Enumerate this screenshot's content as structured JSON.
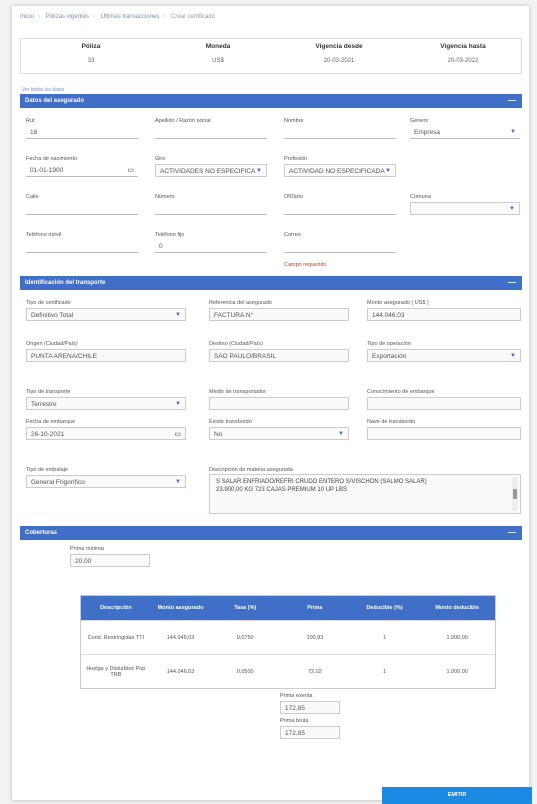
{
  "breadcrumb": [
    "Inicio",
    "Pólizas vigentes",
    "Últimas transacciones",
    "Crear certificado"
  ],
  "summary": {
    "headers": [
      "Póliza",
      "Moneda",
      "Vigencia desde",
      "Vigencia hasta"
    ],
    "values": [
      "33",
      "US$",
      "20-03-2021",
      "20-03-2022"
    ]
  },
  "small_link": "Ver todos los datos",
  "asegurado": {
    "title": "Datos del asegurado",
    "rut_label": "Rut",
    "rut_value": "18",
    "apellido_label": "Apellido / Razón social",
    "apellido_value": "",
    "nombre_label": "Nombre",
    "nombre_value": "",
    "genero_label": "Género",
    "genero_value": "Empresa",
    "fecha_nac_label": "Fecha de nacimiento",
    "fecha_nac_value": "01-01-1900",
    "giro_label": "Giro",
    "giro_value": "ACTIVIDADES NO ESPECIFICA",
    "profesion_label": "Profesión",
    "profesion_value": "ACTIVIDAD NO ESPECIFICADA",
    "calle_label": "Calle",
    "calle_value": "",
    "numero_label": "Número",
    "numero_value": "",
    "ofdpto_label": "Of/Dpto",
    "ofdpto_value": "",
    "comuna_label": "Comuna",
    "comuna_value": "",
    "tel_movil_label": "Teléfono móvil",
    "tel_movil_value": "",
    "tel_fijo_label": "Teléfono fijo",
    "tel_fijo_value": "0",
    "correo_label": "Correo",
    "correo_value": "",
    "correo_error": "Campo requerido"
  },
  "transporte": {
    "title": "Identificación del transporte",
    "tipo_cert_label": "Tipo de certificado",
    "tipo_cert_value": "Definitivo Total",
    "referencia_label": "Referencia del asegurado",
    "referencia_value": "FACTURA N°",
    "monto_label": "Monto asegurado ( US$ )",
    "monto_value": "144.046,03",
    "origen_label": "Origen (Ciudad/País)",
    "origen_value": "PUNTA ARENA/CHILE",
    "destino_label": "Destino (Ciudad/País)",
    "destino_value": "SAO PAULO/BRASIL",
    "tipo_op_label": "Tipo de operación",
    "tipo_op_value": "Exportación",
    "tipo_transp_label": "Tipo de transporte",
    "tipo_transp_value": "Terrestre",
    "medio_label": "Medio de transportador",
    "medio_value": "",
    "conocimiento_label": "Conocimiento de embarque",
    "conocimiento_value": "",
    "fecha_emb_label": "Fecha de embarque",
    "fecha_emb_value": "26-10-2021",
    "existe_transb_label": "Existe transbordo",
    "existe_transb_value": "No",
    "nave_transb_label": "Nave de transbordo",
    "nave_transb_value": "",
    "tipo_embalaje_label": "Tipo de embalaje",
    "tipo_embalaje_value": "General Frigorífico",
    "descripcion_label": "Descripción de materia asegurada",
    "descripcion_line1": "S SALAR ENFRIADO/REFRI CRUDO ENTERO S/VISCHON (SALMO SALAR)",
    "descripcion_line2": "23.900,00 KG      723 CAJAS        PREMIUM 10 UP LBS"
  },
  "coberturas": {
    "title": "Coberturas",
    "prima_minima_label": "Prima mínima",
    "prima_minima_value": "20,00",
    "headers": [
      "Descripción",
      "Monto asegurado",
      "Tasa (%)",
      "Prima",
      "Deducible (%)",
      "Monto deducible"
    ],
    "rows": [
      [
        "Cond. Restringidas TTI",
        "144.046,03",
        "0,0750",
        "100,83",
        "1",
        "1.000,00"
      ],
      [
        "Huelga y Disturbios Pop TRB",
        "144.046,03",
        "0,0500",
        "72,02",
        "1",
        "1.000,00"
      ]
    ],
    "prima_exenta_label": "Prima exenta",
    "prima_exenta_value": "172,85",
    "prima_bruta_label": "Prima bruta",
    "prima_bruta_value": "172,85"
  },
  "submit_label": "EMITIR",
  "colors": {
    "band": "#3f6fc6",
    "button": "#1b8ae3",
    "error": "#c0392b"
  }
}
